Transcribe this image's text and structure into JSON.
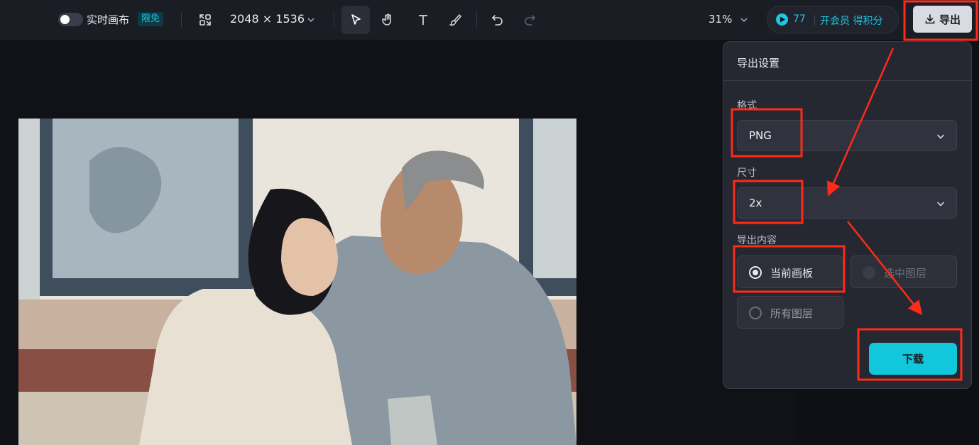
{
  "toolbar": {
    "realtime_canvas_label": "实时画布",
    "free_badge": "限免",
    "canvas_size": "2048 × 1536",
    "zoom": "31%",
    "points_count": "77",
    "points_cta": "开会员 得积分",
    "export_label": "导出",
    "tools": [
      "select-tool-icon",
      "hand-tool-icon",
      "text-tool-icon",
      "brush-tool-icon",
      "undo-icon",
      "redo-icon"
    ]
  },
  "export_panel": {
    "title": "导出设置",
    "format_label": "格式",
    "format_value": "PNG",
    "size_label": "尺寸",
    "size_value": "2x",
    "content_label": "导出内容",
    "content_options": [
      {
        "label": "当前画板",
        "state": "selected"
      },
      {
        "label": "选中图层",
        "state": "disabled"
      },
      {
        "label": "所有图层",
        "state": "unselected"
      }
    ],
    "download_label": "下载"
  },
  "colors": {
    "accent": "#12c6dc",
    "annotation": "#ff2a1a",
    "toolbar_bg": "#1b1d25",
    "panel_bg": "#262831"
  },
  "artboard": {
    "description_icon": "illustration-image"
  }
}
